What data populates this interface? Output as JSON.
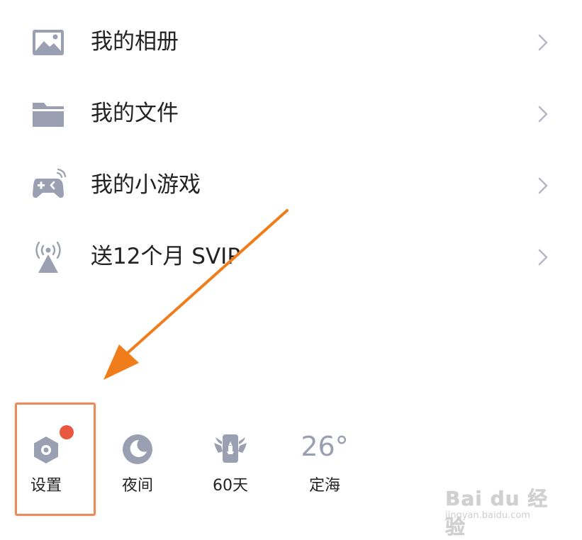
{
  "menu": {
    "items": [
      {
        "label": "我的相册",
        "icon": "photo-album-icon"
      },
      {
        "label": "我的文件",
        "icon": "folder-icon"
      },
      {
        "label": "我的小游戏",
        "icon": "gamepad-icon"
      },
      {
        "label": "送12个月 SVIP",
        "icon": "broadcast-tower-icon"
      }
    ]
  },
  "toolbar": {
    "settings_label": "设置",
    "night_label": "夜间",
    "days_label": "60天",
    "weather_temp": "26°",
    "weather_city": "定海"
  },
  "watermark": {
    "logo_text": "Bai du 经验",
    "sub_text": "jingyan.baidu.com"
  },
  "colors": {
    "icon_gray": "#9aa0b2",
    "badge_red": "#e8573f",
    "highlight_orange": "#ea8c5a",
    "arrow_orange": "#f07d1a",
    "chevron_gray": "#b4b8c4"
  }
}
